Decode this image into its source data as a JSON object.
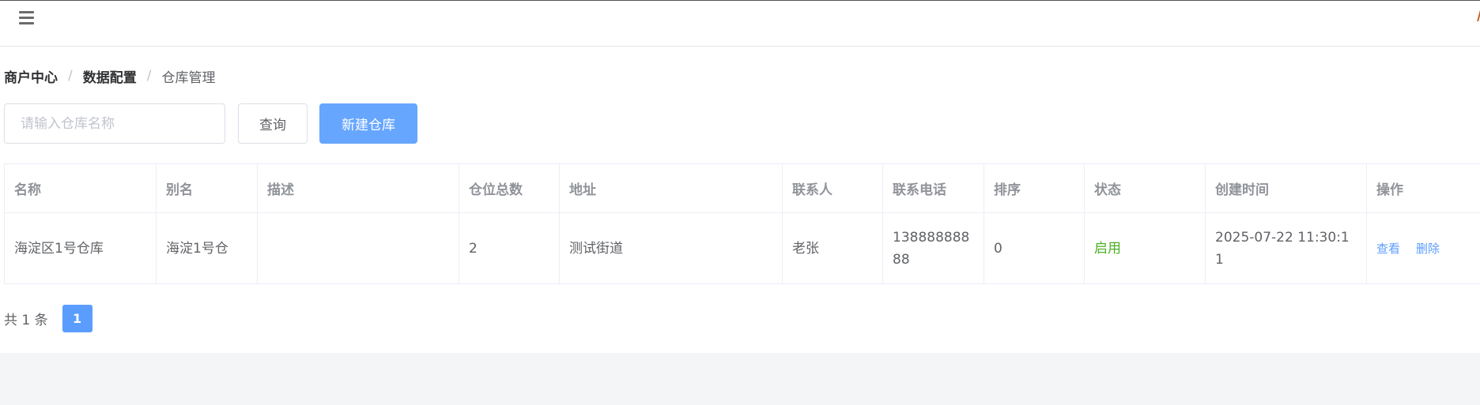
{
  "breadcrumb": {
    "level1": "商户中心",
    "level2": "数据配置",
    "current": "仓库管理",
    "separator": "/"
  },
  "search": {
    "placeholder": "请输入仓库名称",
    "value": ""
  },
  "toolbar": {
    "query_label": "查询",
    "create_label": "新建仓库"
  },
  "table": {
    "columns": [
      "名称",
      "别名",
      "描述",
      "仓位总数",
      "地址",
      "联系人",
      "联系电话",
      "排序",
      "状态",
      "创建时间",
      "操作"
    ],
    "rows": [
      {
        "name": "海淀区1号仓库",
        "alias": "海淀1号仓",
        "description": "",
        "total_slots": "2",
        "address": "测试街道",
        "contact": "老张",
        "phone": "13888888888",
        "sort": "0",
        "status": "启用",
        "created_at": "2025-07-22 11:30:11",
        "actions": {
          "view": "查看",
          "delete": "删除"
        }
      }
    ]
  },
  "pagination": {
    "total_text": "共 1 条",
    "current_page": "1"
  },
  "colors": {
    "primary": "#66a6ff",
    "link": "#5b9dff",
    "status_enabled": "#4caf24",
    "background": "#f4f5f7"
  },
  "icons": {
    "menu": "hamburger-menu-icon"
  }
}
